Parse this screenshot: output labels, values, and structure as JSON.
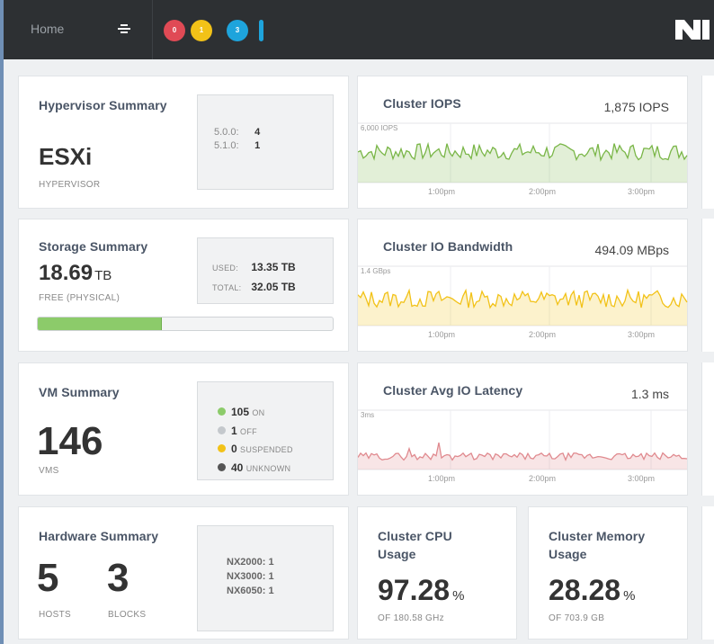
{
  "topbar": {
    "home_label": "Home",
    "alerts": {
      "critical": "0",
      "warning": "1",
      "info": "3"
    }
  },
  "colors": {
    "iops": "#7ab648",
    "bandwidth": "#f2c218",
    "latency": "#e08a8f",
    "storage_bar": "#8ccb6a",
    "alert_red": "#e04a55",
    "alert_yellow": "#f2c218",
    "alert_blue": "#1ea4dc"
  },
  "hypervisor": {
    "title": "Hypervisor Summary",
    "name": "ESXi",
    "caption": "HYPERVISOR",
    "versions": [
      {
        "label": "5.0.0:",
        "count": "4"
      },
      {
        "label": "5.1.0:",
        "count": "1"
      }
    ]
  },
  "storage": {
    "title": "Storage Summary",
    "free_value": "18.69",
    "free_unit": "TB",
    "free_caption": "FREE (PHYSICAL)",
    "used_label": "USED:",
    "used_value": "13.35 TB",
    "total_label": "TOTAL:",
    "total_value": "32.05 TB",
    "used_fraction": 0.42
  },
  "vm": {
    "title": "VM Summary",
    "count": "146",
    "caption": "VMS",
    "states": [
      {
        "count": "105",
        "label": "ON",
        "color": "#8ccb6a"
      },
      {
        "count": "1",
        "label": "OFF",
        "color": "#c4c8cc"
      },
      {
        "count": "0",
        "label": "SUSPENDED",
        "color": "#f2c218"
      },
      {
        "count": "40",
        "label": "UNKNOWN",
        "color": "#555555"
      }
    ]
  },
  "hardware": {
    "title": "Hardware Summary",
    "hosts": "5",
    "hosts_label": "HOSTS",
    "blocks": "3",
    "blocks_label": "BLOCKS",
    "models": [
      "NX2000: 1",
      "NX3000: 1",
      "NX6050: 1"
    ]
  },
  "iops": {
    "title": "Cluster IOPS",
    "value": "1,875 IOPS",
    "scale_label": "6,000 IOPS",
    "ticks": [
      "1:00pm",
      "2:00pm",
      "3:00pm"
    ]
  },
  "bandwidth": {
    "title": "Cluster IO Bandwidth",
    "value": "494.09 MBps",
    "scale_label": "1.4 GBps",
    "ticks": [
      "1:00pm",
      "2:00pm",
      "3:00pm"
    ]
  },
  "latency": {
    "title": "Cluster Avg IO Latency",
    "value": "1.3 ms",
    "scale_label": "3ms",
    "ticks": [
      "1:00pm",
      "2:00pm",
      "3:00pm"
    ]
  },
  "cpu": {
    "title_line1": "Cluster CPU",
    "title_line2": "Usage",
    "value": "97.28",
    "unit": "%",
    "caption": "OF 180.58 GHz"
  },
  "memory": {
    "title_line1": "Cluster Memory",
    "title_line2": "Usage",
    "value": "28.28",
    "unit": "%",
    "caption": "OF 703.9 GB"
  }
}
